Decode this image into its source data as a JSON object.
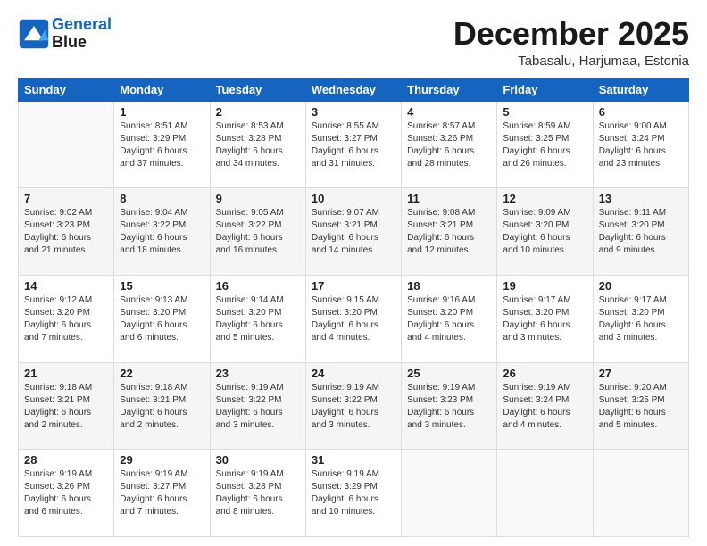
{
  "header": {
    "logo_line1": "General",
    "logo_line2": "Blue",
    "month": "December 2025",
    "location": "Tabasalu, Harjumaa, Estonia"
  },
  "weekdays": [
    "Sunday",
    "Monday",
    "Tuesday",
    "Wednesday",
    "Thursday",
    "Friday",
    "Saturday"
  ],
  "weeks": [
    [
      {
        "day": "",
        "info": ""
      },
      {
        "day": "1",
        "info": "Sunrise: 8:51 AM\nSunset: 3:29 PM\nDaylight: 6 hours\nand 37 minutes."
      },
      {
        "day": "2",
        "info": "Sunrise: 8:53 AM\nSunset: 3:28 PM\nDaylight: 6 hours\nand 34 minutes."
      },
      {
        "day": "3",
        "info": "Sunrise: 8:55 AM\nSunset: 3:27 PM\nDaylight: 6 hours\nand 31 minutes."
      },
      {
        "day": "4",
        "info": "Sunrise: 8:57 AM\nSunset: 3:26 PM\nDaylight: 6 hours\nand 28 minutes."
      },
      {
        "day": "5",
        "info": "Sunrise: 8:59 AM\nSunset: 3:25 PM\nDaylight: 6 hours\nand 26 minutes."
      },
      {
        "day": "6",
        "info": "Sunrise: 9:00 AM\nSunset: 3:24 PM\nDaylight: 6 hours\nand 23 minutes."
      }
    ],
    [
      {
        "day": "7",
        "info": "Sunrise: 9:02 AM\nSunset: 3:23 PM\nDaylight: 6 hours\nand 21 minutes."
      },
      {
        "day": "8",
        "info": "Sunrise: 9:04 AM\nSunset: 3:22 PM\nDaylight: 6 hours\nand 18 minutes."
      },
      {
        "day": "9",
        "info": "Sunrise: 9:05 AM\nSunset: 3:22 PM\nDaylight: 6 hours\nand 16 minutes."
      },
      {
        "day": "10",
        "info": "Sunrise: 9:07 AM\nSunset: 3:21 PM\nDaylight: 6 hours\nand 14 minutes."
      },
      {
        "day": "11",
        "info": "Sunrise: 9:08 AM\nSunset: 3:21 PM\nDaylight: 6 hours\nand 12 minutes."
      },
      {
        "day": "12",
        "info": "Sunrise: 9:09 AM\nSunset: 3:20 PM\nDaylight: 6 hours\nand 10 minutes."
      },
      {
        "day": "13",
        "info": "Sunrise: 9:11 AM\nSunset: 3:20 PM\nDaylight: 6 hours\nand 9 minutes."
      }
    ],
    [
      {
        "day": "14",
        "info": "Sunrise: 9:12 AM\nSunset: 3:20 PM\nDaylight: 6 hours\nand 7 minutes."
      },
      {
        "day": "15",
        "info": "Sunrise: 9:13 AM\nSunset: 3:20 PM\nDaylight: 6 hours\nand 6 minutes."
      },
      {
        "day": "16",
        "info": "Sunrise: 9:14 AM\nSunset: 3:20 PM\nDaylight: 6 hours\nand 5 minutes."
      },
      {
        "day": "17",
        "info": "Sunrise: 9:15 AM\nSunset: 3:20 PM\nDaylight: 6 hours\nand 4 minutes."
      },
      {
        "day": "18",
        "info": "Sunrise: 9:16 AM\nSunset: 3:20 PM\nDaylight: 6 hours\nand 4 minutes."
      },
      {
        "day": "19",
        "info": "Sunrise: 9:17 AM\nSunset: 3:20 PM\nDaylight: 6 hours\nand 3 minutes."
      },
      {
        "day": "20",
        "info": "Sunrise: 9:17 AM\nSunset: 3:20 PM\nDaylight: 6 hours\nand 3 minutes."
      }
    ],
    [
      {
        "day": "21",
        "info": "Sunrise: 9:18 AM\nSunset: 3:21 PM\nDaylight: 6 hours\nand 2 minutes."
      },
      {
        "day": "22",
        "info": "Sunrise: 9:18 AM\nSunset: 3:21 PM\nDaylight: 6 hours\nand 2 minutes."
      },
      {
        "day": "23",
        "info": "Sunrise: 9:19 AM\nSunset: 3:22 PM\nDaylight: 6 hours\nand 3 minutes."
      },
      {
        "day": "24",
        "info": "Sunrise: 9:19 AM\nSunset: 3:22 PM\nDaylight: 6 hours\nand 3 minutes."
      },
      {
        "day": "25",
        "info": "Sunrise: 9:19 AM\nSunset: 3:23 PM\nDaylight: 6 hours\nand 3 minutes."
      },
      {
        "day": "26",
        "info": "Sunrise: 9:19 AM\nSunset: 3:24 PM\nDaylight: 6 hours\nand 4 minutes."
      },
      {
        "day": "27",
        "info": "Sunrise: 9:20 AM\nSunset: 3:25 PM\nDaylight: 6 hours\nand 5 minutes."
      }
    ],
    [
      {
        "day": "28",
        "info": "Sunrise: 9:19 AM\nSunset: 3:26 PM\nDaylight: 6 hours\nand 6 minutes."
      },
      {
        "day": "29",
        "info": "Sunrise: 9:19 AM\nSunset: 3:27 PM\nDaylight: 6 hours\nand 7 minutes."
      },
      {
        "day": "30",
        "info": "Sunrise: 9:19 AM\nSunset: 3:28 PM\nDaylight: 6 hours\nand 8 minutes."
      },
      {
        "day": "31",
        "info": "Sunrise: 9:19 AM\nSunset: 3:29 PM\nDaylight: 6 hours\nand 10 minutes."
      },
      {
        "day": "",
        "info": ""
      },
      {
        "day": "",
        "info": ""
      },
      {
        "day": "",
        "info": ""
      }
    ]
  ]
}
